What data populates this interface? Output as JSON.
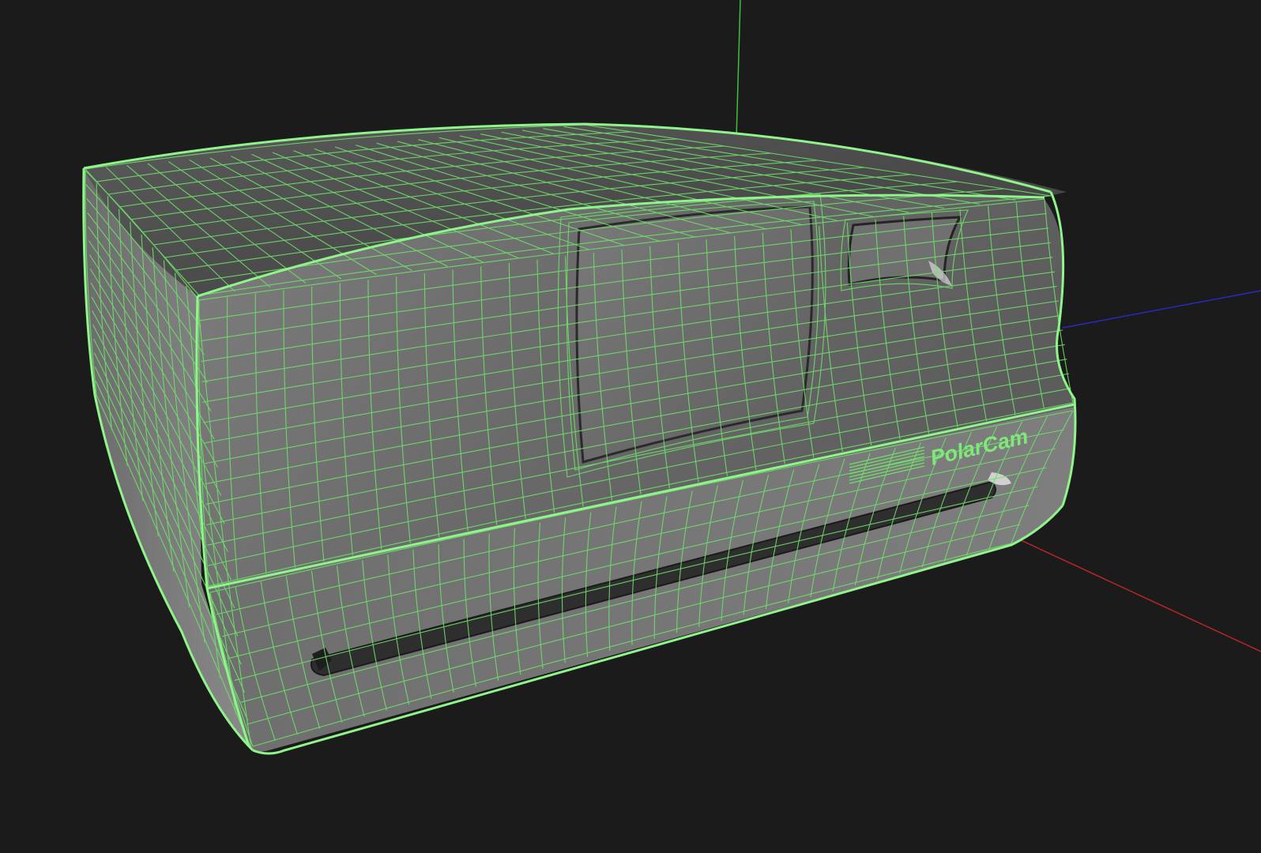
{
  "viewport": {
    "background": "#1b1b1b",
    "view_mode": "wireframe-on-shaded"
  },
  "colors": {
    "wire": "#6fe06a",
    "wire_bright": "#8ff58a",
    "axis_x": "#b8262a",
    "axis_y": "#3fbf3f",
    "axis_z": "#2a2ac0",
    "shade_light": "#8c8c8c",
    "shade_mid": "#6e6e6e",
    "shade_dark": "#3c3c3c"
  },
  "model": {
    "name": "camera-body",
    "brand_label": "PolarCam"
  },
  "axes": {
    "x": "x-axis",
    "y": "y-axis",
    "z": "z-axis"
  }
}
